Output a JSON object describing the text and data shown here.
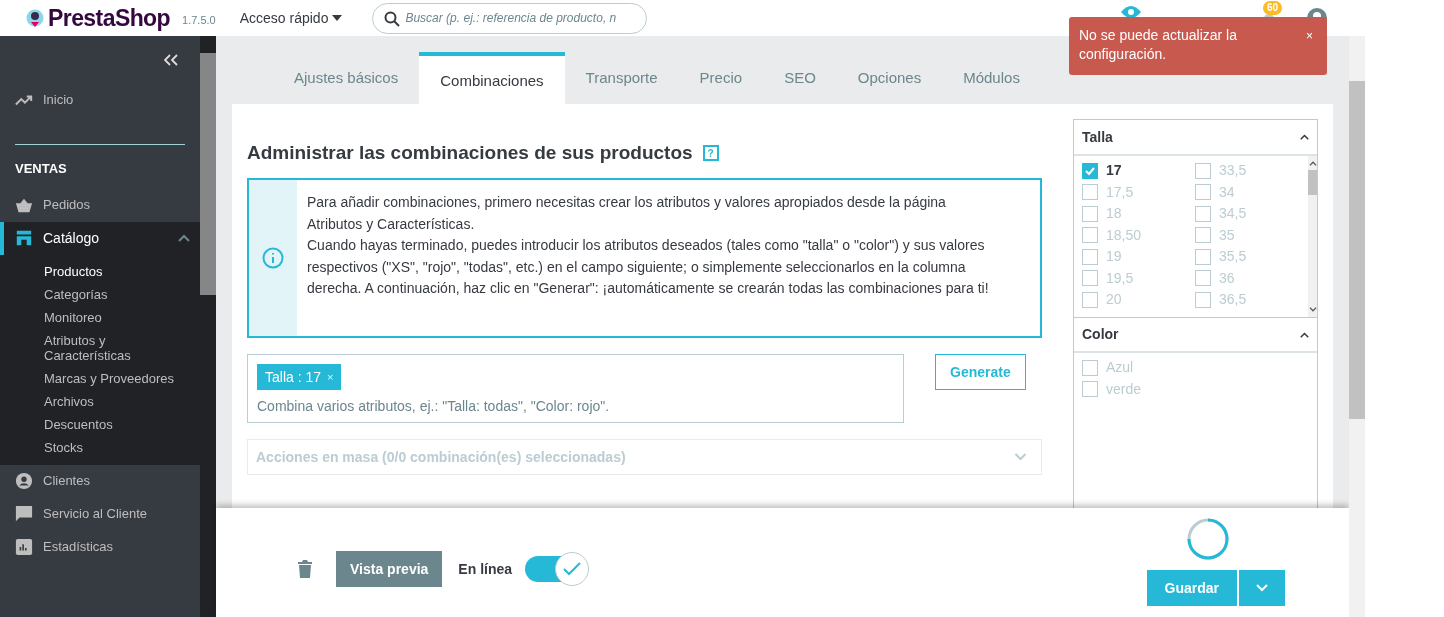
{
  "header": {
    "logo": "PrestaShop",
    "version": "1.7.5.0",
    "quick_access": "Acceso rápido",
    "search_placeholder": "Buscar (p. ej.: referencia de producto, n",
    "notifications": "60"
  },
  "toast": {
    "message": "No se puede actualizar la configuración.",
    "close": "×"
  },
  "sidebar": {
    "items": [
      {
        "kind": "link",
        "label": "Inicio",
        "selected": false
      },
      {
        "kind": "section",
        "label": "VENTAS"
      },
      {
        "kind": "link",
        "label": "Pedidos",
        "selected": false
      },
      {
        "kind": "group",
        "label": "Catálogo",
        "selected": true,
        "expanded": true,
        "children": [
          {
            "label": "Productos",
            "selected": true
          },
          {
            "label": "Categorías",
            "selected": false
          },
          {
            "label": "Monitoreo",
            "selected": false
          },
          {
            "label": "Atributos y Características",
            "selected": false
          },
          {
            "label": "Marcas y Proveedores",
            "selected": false
          },
          {
            "label": "Archivos",
            "selected": false
          },
          {
            "label": "Descuentos",
            "selected": false
          },
          {
            "label": "Stocks",
            "selected": false
          }
        ]
      },
      {
        "kind": "link",
        "label": "Clientes",
        "selected": false
      },
      {
        "kind": "link",
        "label": "Servicio al Cliente",
        "selected": false
      },
      {
        "kind": "link",
        "label": "Estadísticas",
        "selected": false
      }
    ]
  },
  "tabs": [
    {
      "label": "Ajustes básicos",
      "selected": false
    },
    {
      "label": "Combinaciones",
      "selected": true
    },
    {
      "label": "Transporte",
      "selected": false
    },
    {
      "label": "Precio",
      "selected": false
    },
    {
      "label": "SEO",
      "selected": false
    },
    {
      "label": "Opciones",
      "selected": false
    },
    {
      "label": "Módulos",
      "selected": false
    }
  ],
  "panel": {
    "title": "Administrar las combinaciones de sus productos",
    "help": "?",
    "info": [
      "Para añadir combinaciones, primero necesitas crear los atributos y valores apropiados desde la página Atributos y Características.",
      "Cuando hayas terminado, puedes introducir los atributos deseados (tales como \"talla\" o \"color\") y sus valores respectivos (\"XS\", \"rojo\", \"todas\", etc.) en el campo siguiente; o simplemente seleccionarlos en la columna derecha. A continuación, haz clic en \"Generar\": ¡automáticamente se crearán todas las combinaciones para ti!"
    ],
    "tags": [
      {
        "label": "Talla : 17",
        "remove": "×"
      }
    ],
    "hint": "Combina varios atributos, ej.: \"Talla: todas\", \"Color: rojo\".",
    "generate": "Generate",
    "bulk_actions": {
      "label": "Acciones en masa (0/0 combinación(es) seleccionadas)",
      "expanded": false
    }
  },
  "attributes": [
    {
      "name": "Talla",
      "expanded": true,
      "values": [
        {
          "label": "17",
          "checked": true
        },
        {
          "label": "17,5",
          "checked": false
        },
        {
          "label": "18",
          "checked": false
        },
        {
          "label": "18,50",
          "checked": false
        },
        {
          "label": "19",
          "checked": false
        },
        {
          "label": "19,5",
          "checked": false
        },
        {
          "label": "20",
          "checked": false
        },
        {
          "label": "33,5",
          "checked": false
        },
        {
          "label": "34",
          "checked": false
        },
        {
          "label": "34,5",
          "checked": false
        },
        {
          "label": "35",
          "checked": false
        },
        {
          "label": "35,5",
          "checked": false
        },
        {
          "label": "36",
          "checked": false
        },
        {
          "label": "36,5",
          "checked": false
        }
      ]
    },
    {
      "name": "Color",
      "expanded": true,
      "values": [
        {
          "label": "Azul",
          "checked": false
        },
        {
          "label": "verde",
          "checked": false
        }
      ]
    }
  ],
  "footer": {
    "preview": "Vista previa",
    "online_label": "En línea",
    "online": true,
    "save": "Guardar"
  }
}
